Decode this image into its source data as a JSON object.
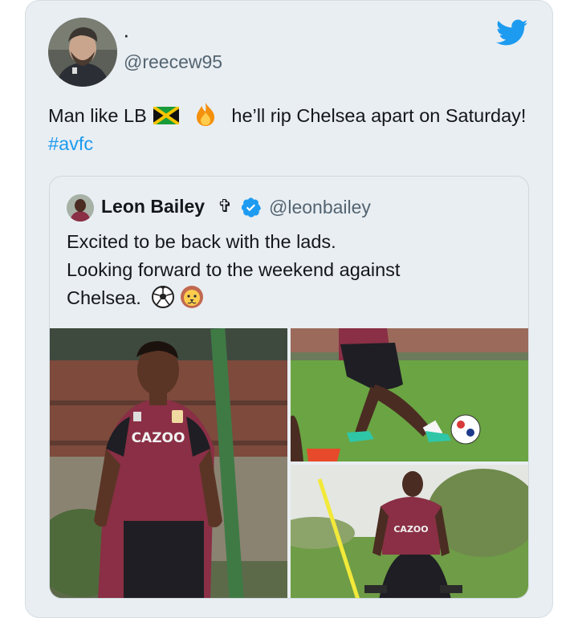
{
  "tweet": {
    "display_name": "·",
    "handle": "@reecew95",
    "text_part1": "Man like LB",
    "text_part2": "he’ll rip Chelsea apart on Saturday!",
    "hashtag": "#avfc",
    "icons": [
      "twitter-logo-icon",
      "jamaica-flag-icon",
      "fire-icon"
    ]
  },
  "quoted": {
    "name": "Leon Bailey",
    "name_symbol": "✞",
    "handle": "@leonbailey",
    "line1": "Excited to be back with the lads.",
    "line2": "Looking forward to the weekend against",
    "line3": "Chelsea.",
    "icons": [
      "verified-badge-icon",
      "soccer-ball-icon",
      "lion-face-icon"
    ],
    "photo_text": {
      "shirt_sponsor": "CAZOO"
    }
  },
  "colors": {
    "card_background": "#e9eef2",
    "link": "#1d9bf0",
    "secondary_text": "#536471",
    "shirt_claret": "#8a2f45"
  }
}
